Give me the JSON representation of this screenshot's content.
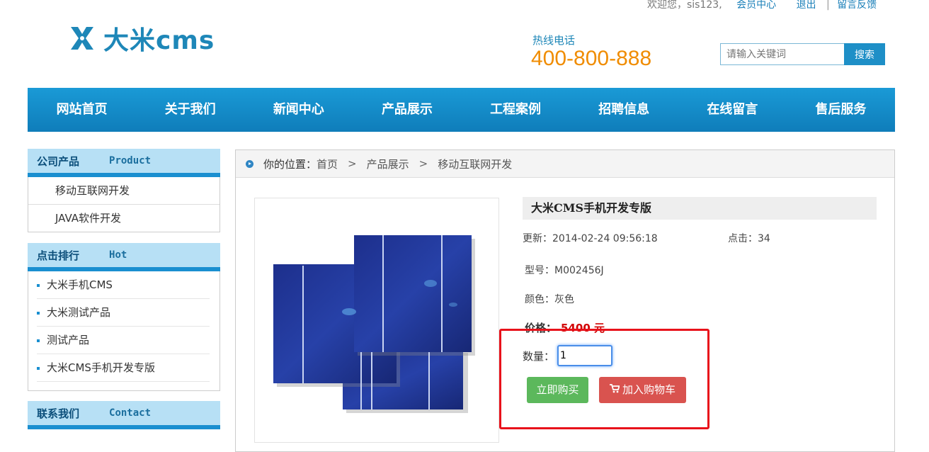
{
  "header": {
    "welcome": "欢迎您，sis123,",
    "member_center": "会员中心",
    "logout": "退出",
    "separator": "|",
    "feedback": "留言反馈",
    "logo_text": "大米cms",
    "hotline_label": "热线电话",
    "hotline_number": "400-800-888",
    "search_placeholder": "请输入关键词",
    "search_button": "搜索"
  },
  "nav": [
    "网站首页",
    "关于我们",
    "新闻中心",
    "产品展示",
    "工程案例",
    "招聘信息",
    "在线留言",
    "售后服务"
  ],
  "sidebar": {
    "products": {
      "title_cn": "公司产品",
      "title_en": "Product",
      "items": [
        "移动互联网开发",
        "JAVA软件开发"
      ]
    },
    "hot": {
      "title_cn": "点击排行",
      "title_en": "Hot",
      "items": [
        "大米手机CMS",
        "大米测试产品",
        "测试产品",
        "大米CMS手机开发专版"
      ]
    },
    "contact": {
      "title_cn": "联系我们",
      "title_en": "Contact"
    }
  },
  "breadcrumb": {
    "label": "你的位置：",
    "home": "首页",
    "arrow": ">",
    "category": "产品展示",
    "current": "移动互联网开发"
  },
  "product": {
    "title": "大米CMS手机开发专版",
    "updated_label": "更新：",
    "updated_value": "2014-02-24 09:56:18",
    "clicks_label": "点击：",
    "clicks_value": "34",
    "model_label": "型号：",
    "model_value": "M002456J",
    "color_label": "颜色：",
    "color_value": "灰色",
    "price_label": "价格：",
    "price_value": "5400 元",
    "qty_label": "数量：",
    "qty_value": "1",
    "buy_now": "立即购买",
    "add_cart": "加入购物车"
  },
  "colors": {
    "nav": "#1a8fd0",
    "accent_orange": "#f08c00",
    "buy": "#5cb85c",
    "cart": "#d9534f",
    "highlight": "#e8121b"
  }
}
